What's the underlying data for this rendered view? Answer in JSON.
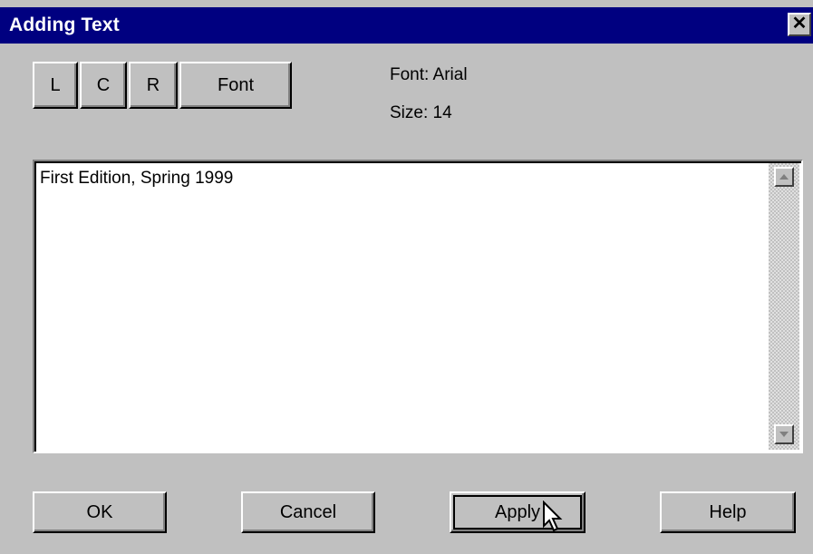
{
  "window": {
    "title": "Adding Text",
    "close_glyph": "✕"
  },
  "toolbar": {
    "left_label": "L",
    "center_label": "C",
    "right_label": "R",
    "font_label": "Font"
  },
  "font_info": {
    "font_line": "Font:  Arial",
    "size_line": "Size:  14"
  },
  "editor": {
    "text": "First Edition, Spring 1999"
  },
  "scrollbar": {
    "up_icon": "scroll-up-arrow",
    "down_icon": "scroll-down-arrow"
  },
  "footer": {
    "ok_label": "OK",
    "cancel_label": "Cancel",
    "apply_label": "Apply",
    "help_label": "Help"
  },
  "colors": {
    "titlebar": "#000080",
    "face": "#c0c0c0"
  }
}
